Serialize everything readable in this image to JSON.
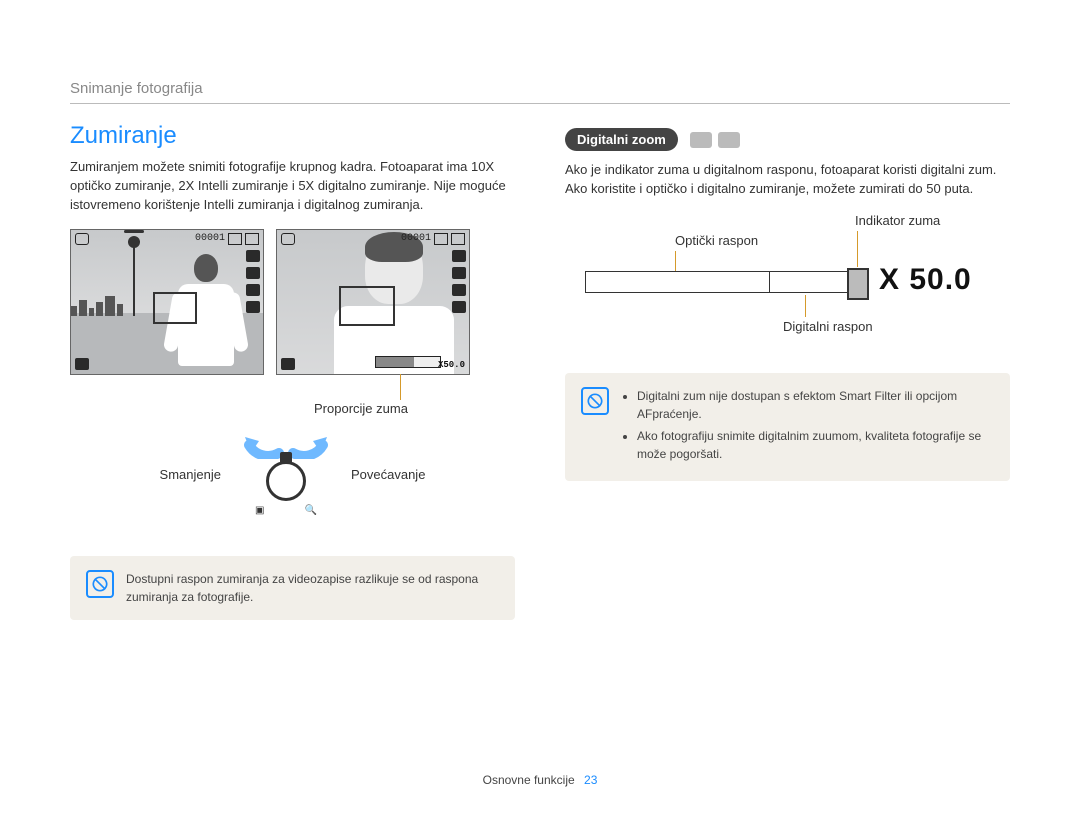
{
  "header": {
    "section": "Snimanje fotografija"
  },
  "left": {
    "title": "Zumiranje",
    "paragraph": "Zumiranjem možete snimiti fotografije krupnog kadra. Fotoaparat ima 10X optičko zumiranje, 2X Intelli zumiranje i 5X digitalno zumiranje. Nije moguće istovremeno korištenje Intelli zumiranja i digitalnog zumiranja.",
    "osd_counter": "00001",
    "osd_zoom_value": "X50.0",
    "callout_proportions": "Proporcije zuma",
    "label_decrease": "Smanjenje",
    "label_increase": "Povećavanje",
    "note": "Dostupni raspon zumiranja za videozapise razlikuje se od raspona zumiranja za fotografije."
  },
  "right": {
    "pill": "Digitalni zoom",
    "paragraph": "Ako je indikator zuma u digitalnom rasponu, fotoaparat koristi digitalni zum. Ako koristite i optičko i digitalno zumiranje, možete zumirati do 50 puta.",
    "label_indicator": "Indikator zuma",
    "label_optical": "Optički raspon",
    "label_digital": "Digitalni raspon",
    "zoom_readout": "X 50.0",
    "note_items": [
      "Digitalni zum nije dostupan s efektom Smart Filter ili opcijom AFpraćenje.",
      "Ako fotografiju snimite digitalnim zuumom, kvaliteta fotografije se može pogoršati."
    ]
  },
  "footer": {
    "label": "Osnovne funkcije",
    "page": "23"
  }
}
